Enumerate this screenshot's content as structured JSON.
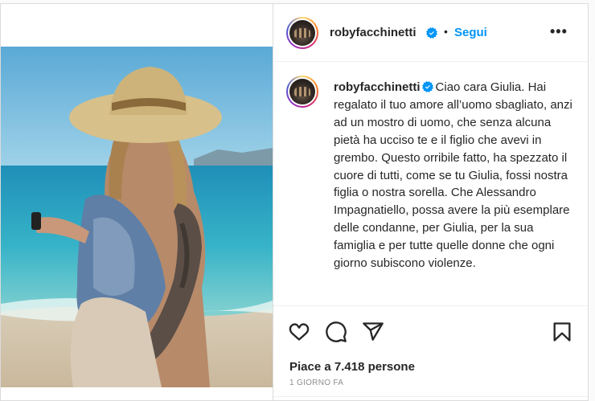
{
  "post": {
    "username": "robyfacchinetti",
    "follow_label": "Segui",
    "separator": "•",
    "more_label": "•••",
    "caption_user": "robyfacchinetti",
    "caption_text": "Ciao cara Giulia. Hai regalato il tuo amore all’uomo sbagliato, anzi ad un mostro di uomo, che senza alcuna pietà ha ucciso te e il figlio che avevi in grembo. Questo orribile fatto, ha spezzato il cuore di tutti, come se tu Giulia, fossi nostra figlia o nostra sorella. Che Alessandro Impagnatiello, possa avere la più esemplare delle condanne, per Giulia, per la sua famiglia e per tutte quelle donne che ogni giorno subiscono violenze.",
    "likes_text": "Piace a 7.418 persone",
    "time_text": "1 GIORNO FA"
  },
  "icons": {
    "like": "heart-icon",
    "comment": "comment-icon",
    "share": "share-icon",
    "save": "bookmark-icon",
    "verified": "verified-badge-icon"
  },
  "colors": {
    "follow": "#0095f6",
    "verified": "#0095f6",
    "text": "#262626",
    "muted": "#8e8e8e"
  }
}
